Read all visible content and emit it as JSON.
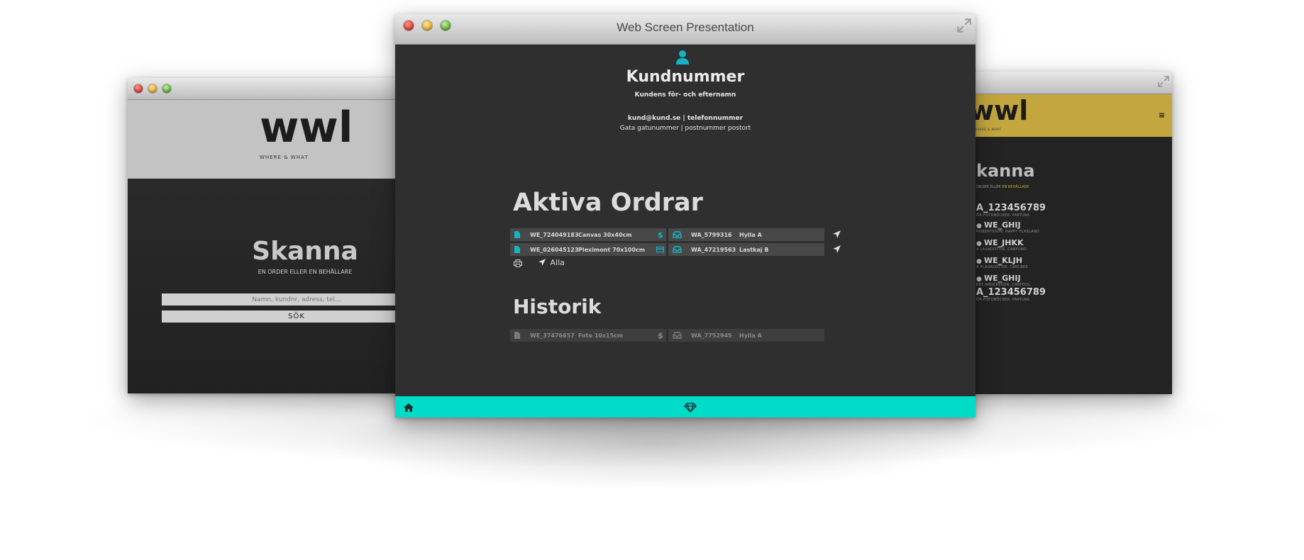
{
  "center_window": {
    "title": "Web Screen Presentation",
    "customer": {
      "heading": "Kundnummer",
      "name": "Kundens för- och efternamn",
      "contact": "kund@kund.se | telefonnummer",
      "address": "Gata gatunummer | postnummer postort"
    },
    "active_orders": {
      "heading": "Aktiva Ordrar",
      "rows": [
        {
          "order_id": "WE_724049183",
          "product": "Canvas 30x40cm",
          "status_icon": "dollar-icon",
          "container_id": "WA_5799316",
          "location": "Hylla A"
        },
        {
          "order_id": "WE_026045123",
          "product": "Pleximont 70x100cm",
          "status_icon": "card-icon",
          "container_id": "WA_47219563",
          "location": "Lastkaj B"
        }
      ],
      "all_label": "Alla"
    },
    "history": {
      "heading": "Historik",
      "rows": [
        {
          "order_id": "WE_37476657",
          "product": "Foto 10x15cm",
          "status_icon": "dollar-icon",
          "container_id": "WA_7752945",
          "location": "Hylla A"
        }
      ]
    }
  },
  "left_window": {
    "logo": "wwl",
    "tagline": "WHERE & WHAT",
    "scan_title": "Skanna",
    "scan_subtitle": "EN ORDER ELLER EN BEHÅLLARE",
    "search_placeholder": "Namn, kundnr, adress, tel...",
    "search_button": "SÖK"
  },
  "right_window": {
    "logo": "wwl",
    "tagline": "WHERE & WHAT",
    "scan_title": "kanna",
    "scan_subtitle_a": "ORDER ELLER ",
    "scan_subtitle_b": "EN BEHÅLLARE",
    "items": [
      {
        "label": "A_123456789",
        "sub": "ÖR FOTOBÖCKER, FAKTURA"
      },
      {
        "label": "WE_GHIJ",
        "sub": "ROBERTSSON, HAPPY FLASLAND"
      },
      {
        "label": "WE_JHKK",
        "sub": "A LASADOTTIR, CARPOND"
      },
      {
        "label": "WE_KLJH",
        "sub": "A FLASADOTTIR, CARCARE"
      },
      {
        "label": "WE_GHIJ",
        "sub": "ERT ANDERSSON, CARPOOL"
      },
      {
        "label": "A_123456789",
        "sub": "ÖR FOTOBÖCKER, FAKTURA"
      }
    ]
  },
  "colors": {
    "accent_teal": "#00dcc8",
    "icon_teal": "#14b4c4",
    "gold": "#c3a73e",
    "dark_bg": "#2f2f2f",
    "row_bg": "#484848"
  }
}
